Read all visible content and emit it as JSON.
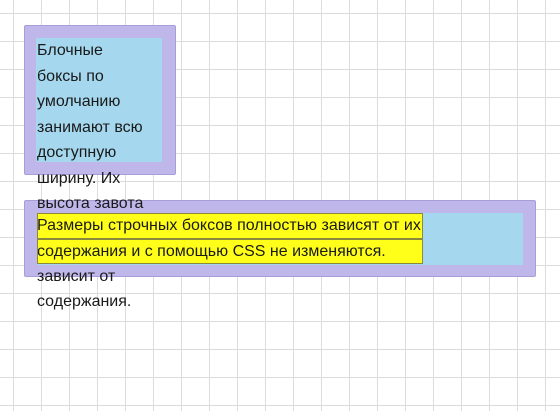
{
  "block_box": {
    "lines": [
      "Блочные",
      "боксы по",
      "умолчанию",
      "занимают всю",
      "доступную",
      "ширину. Их",
      "высота завота"
    ]
  },
  "inline_box": {
    "highlight_lines": [
      "Размеры строчных боксов полностью зависят от их",
      "содержания и с помощью CSS не изменяются."
    ]
  },
  "overflow_text": {
    "lines": [
      "зависит от",
      "содержания."
    ]
  },
  "colors": {
    "outer_box": "#bfb6e9",
    "inner_box": "#a5d8ef",
    "highlight": "#ffff1a",
    "grid": "#dcdcdc"
  }
}
